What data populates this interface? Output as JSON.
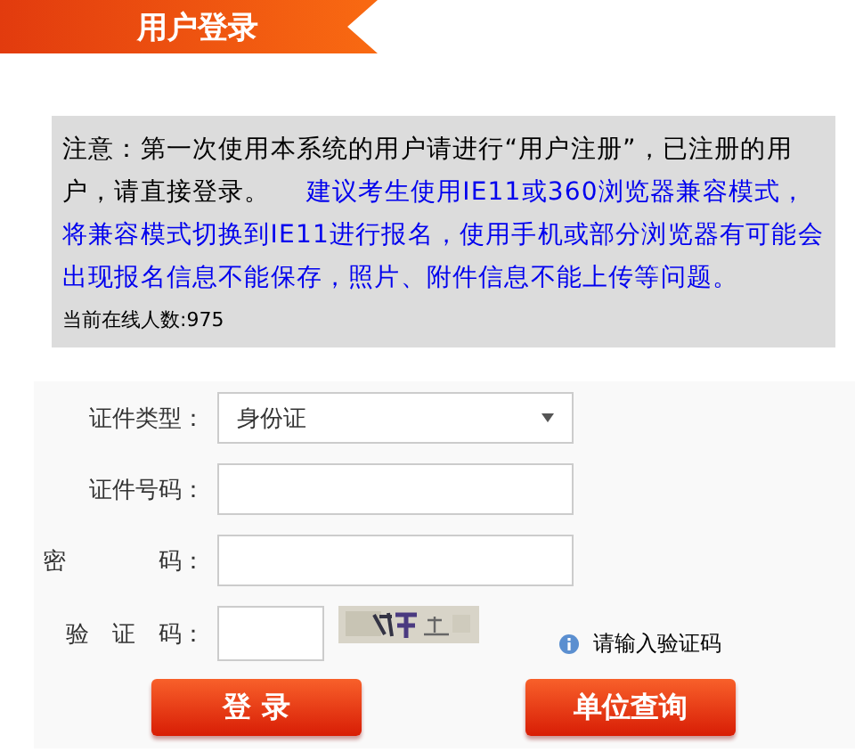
{
  "header": {
    "title": "用户登录"
  },
  "notice": {
    "text": "注意：第一次使用本系统的用户请进行“用户注册”，已注册的用户，请直接登录。",
    "advice": "建议考生使用IE11或360浏览器兼容模式，将兼容模式切换到IE11进行报名，使用手机或部分浏览器有可能会出现报名信息不能保存，照片、附件信息不能上传等问题。",
    "online": "当前在线人数:975"
  },
  "form": {
    "fields": [
      {
        "kind": "select",
        "label": "证件类型：",
        "value": "身份证"
      },
      {
        "kind": "text",
        "label": "证件号码："
      },
      {
        "kind": "password",
        "label": "密　　　　码："
      },
      {
        "kind": "captcha",
        "label": "验　证　码：",
        "hint": "请输入验证码"
      }
    ],
    "buttons": [
      "登 录",
      "单位查询"
    ]
  }
}
